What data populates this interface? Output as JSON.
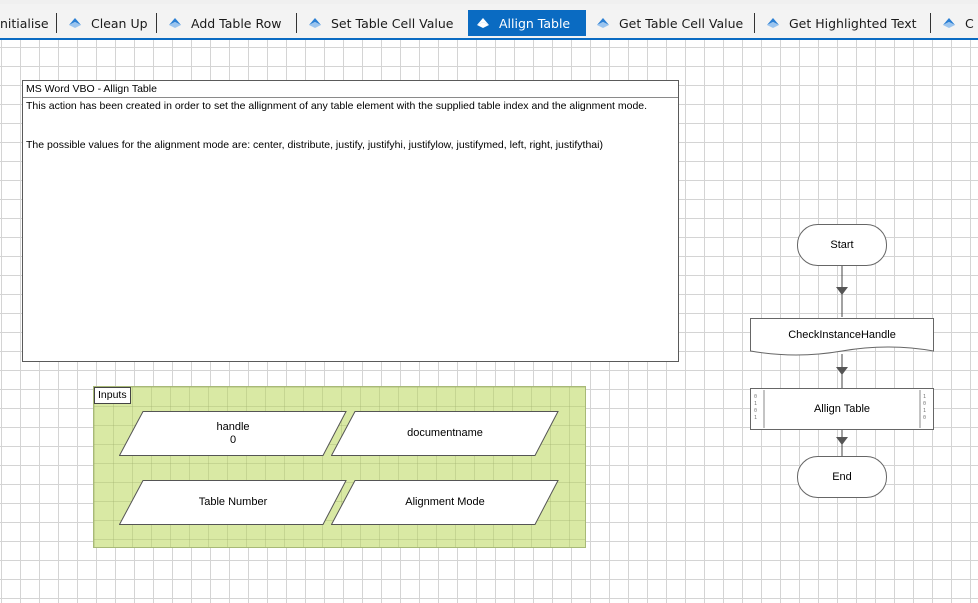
{
  "tabs": [
    {
      "label": "nitialise",
      "icon": "action-icon",
      "active": false
    },
    {
      "label": "Clean Up",
      "icon": "action-icon",
      "active": false
    },
    {
      "label": "Add Table Row",
      "icon": "action-icon",
      "active": false
    },
    {
      "label": "Set Table Cell Value",
      "icon": "action-icon",
      "active": false
    },
    {
      "label": "Allign Table",
      "icon": "action-icon",
      "active": true
    },
    {
      "label": "Get Table Cell Value",
      "icon": "action-icon",
      "active": false
    },
    {
      "label": "Get Highlighted Text",
      "icon": "action-icon",
      "active": false
    },
    {
      "label": "C",
      "icon": "action-icon",
      "active": false
    }
  ],
  "colors": {
    "active_tab": "#0a6bc2",
    "inputs_fill": "#d9e9a4",
    "flow_node_fill": "#ffffff",
    "grid_line": "#d4d4d4"
  },
  "note": {
    "title": "MS Word VBO - Allign Table",
    "paragraph1": "This action has been created in order to set the allignment of any table element with the supplied table index and the alignment mode.",
    "paragraph2": "The possible values for the alignment mode are: center, distribute, justify, justifyhi, justifylow, justifymed, left, right, justifythai)"
  },
  "inputs": {
    "label": "Inputs",
    "params": [
      {
        "name": "handle",
        "value": "0"
      },
      {
        "name": "documentname",
        "value": ""
      },
      {
        "name": "Table Number",
        "value": ""
      },
      {
        "name": "Alignment Mode",
        "value": ""
      }
    ]
  },
  "flow": {
    "start": "Start",
    "check": "CheckInstanceHandle",
    "action": "Allign Table",
    "end": "End"
  }
}
